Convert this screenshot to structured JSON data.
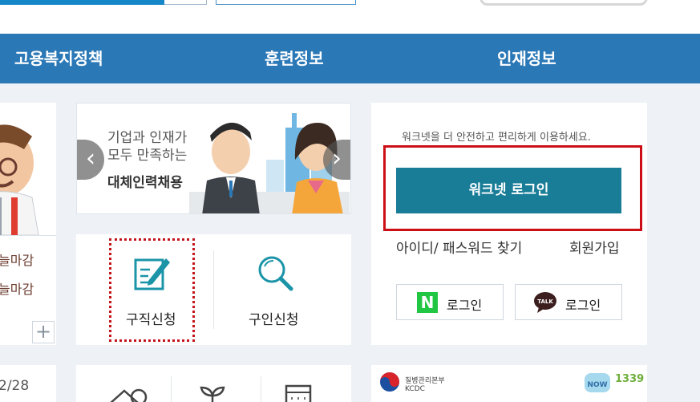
{
  "nav": {
    "items": [
      "고용복지정책",
      "훈련정보",
      "인재정보"
    ]
  },
  "left": {
    "deadlines": [
      "늘마감",
      "늘마감"
    ],
    "more": "+",
    "date": "2/28"
  },
  "banner": {
    "line1": "기업과 인재가",
    "line2": "모두 만족하는",
    "line3": "대체인력채용",
    "prev": "‹",
    "next": "›"
  },
  "quick": {
    "job_apply": "구직신청",
    "recruit_apply": "구인신청"
  },
  "login": {
    "notice": "워크넷을 더 안전하고 편리하게 이용하세요.",
    "button": "워크넷 로그인",
    "find": "아이디/ 패스워드 찾기",
    "join": "회원가입",
    "naver_label": "로그인",
    "naver_mark": "N",
    "kakao_label": "로그인",
    "kakao_mark": "TALK"
  },
  "kcdc": {
    "ko": "질병관리본부",
    "en": "KCDC",
    "badge": "NOW",
    "number": "1339"
  },
  "colors": {
    "nav": "#2b78b7",
    "login_button": "#1a7d98",
    "highlight": "#cc0f17",
    "naver": "#21c742"
  }
}
